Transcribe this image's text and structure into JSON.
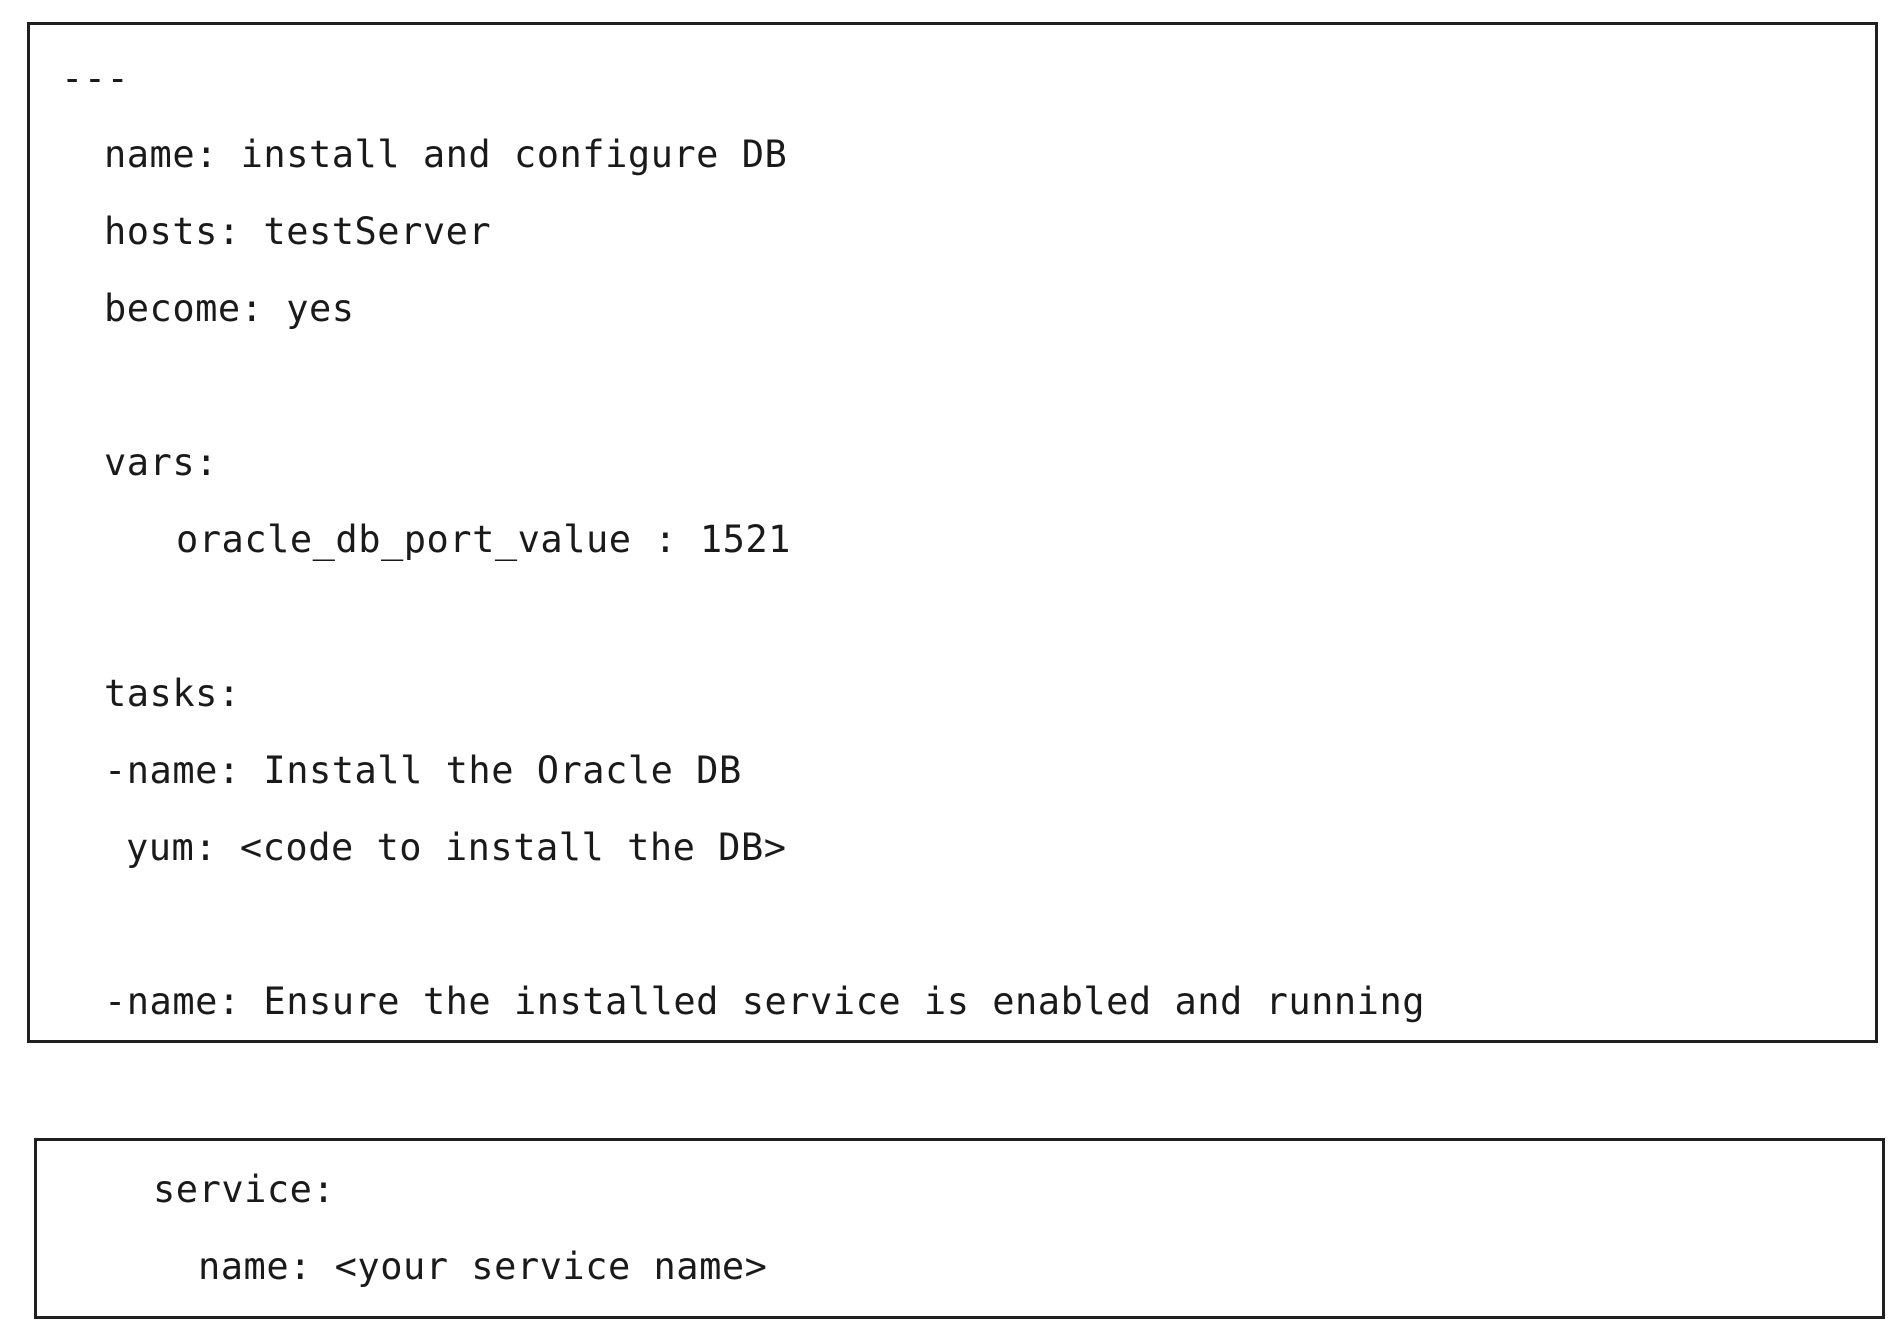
{
  "playbook": {
    "separator": "---",
    "name_line": "name: install and configure DB",
    "hosts_line": "hosts: testServer",
    "become_line": "become: yes",
    "vars_label": "vars:",
    "port_line": "oracle_db_port_value : 1521",
    "tasks_label": "tasks:",
    "task1_name": "-name: Install the Oracle DB",
    "task1_yum": "yum: <code to install the DB>",
    "task2_name": "-name: Ensure the installed service is enabled and running"
  },
  "service_block": {
    "service_label": "service:",
    "service_name_line": "name: <your service name>"
  }
}
